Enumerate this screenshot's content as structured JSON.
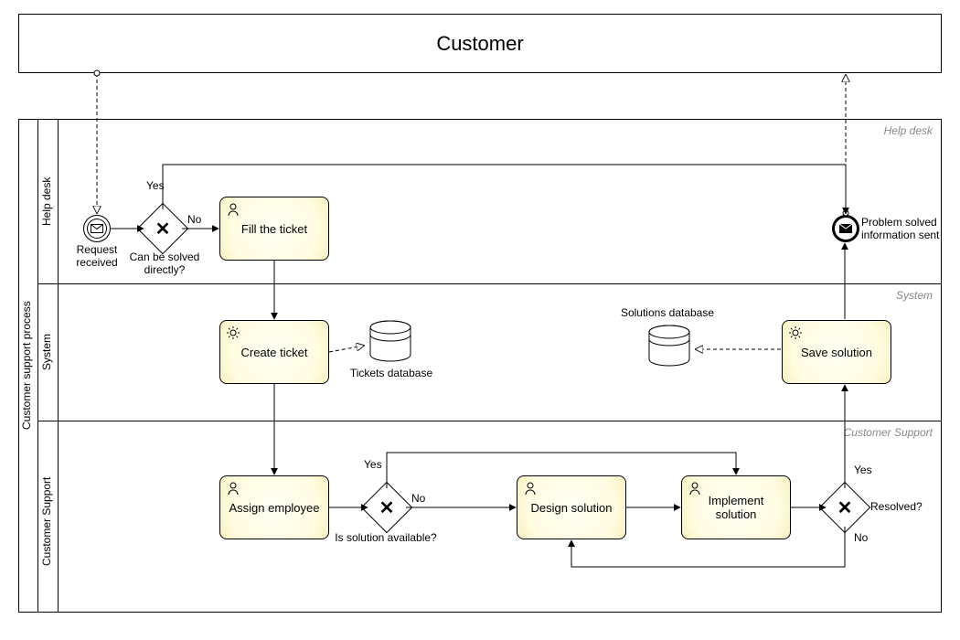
{
  "participants": {
    "customer": "Customer",
    "pool": "Customer support process",
    "lanes": {
      "helpdesk": "Help desk",
      "system": "System",
      "support": "Customer Support"
    }
  },
  "events": {
    "start": "Request received",
    "end": "Problem solved information sent"
  },
  "gateways": {
    "g1": {
      "question": "Can be solved directly?",
      "yes": "Yes",
      "no": "No"
    },
    "g2": {
      "question": "Is solution available?",
      "yes": "Yes",
      "no": "No"
    },
    "g3": {
      "question": "Resolved?",
      "yes": "Yes",
      "no": "No"
    }
  },
  "tasks": {
    "fill": "Fill the ticket",
    "create": "Create ticket",
    "assign": "Assign employee",
    "design": "Design solution",
    "implement": "Implement solution",
    "save": "Save solution"
  },
  "datastores": {
    "tickets": "Tickets database",
    "solutions": "Solutions database"
  },
  "lane_hints": {
    "helpdesk": "Help desk",
    "system": "System",
    "support": "Customer Support"
  }
}
